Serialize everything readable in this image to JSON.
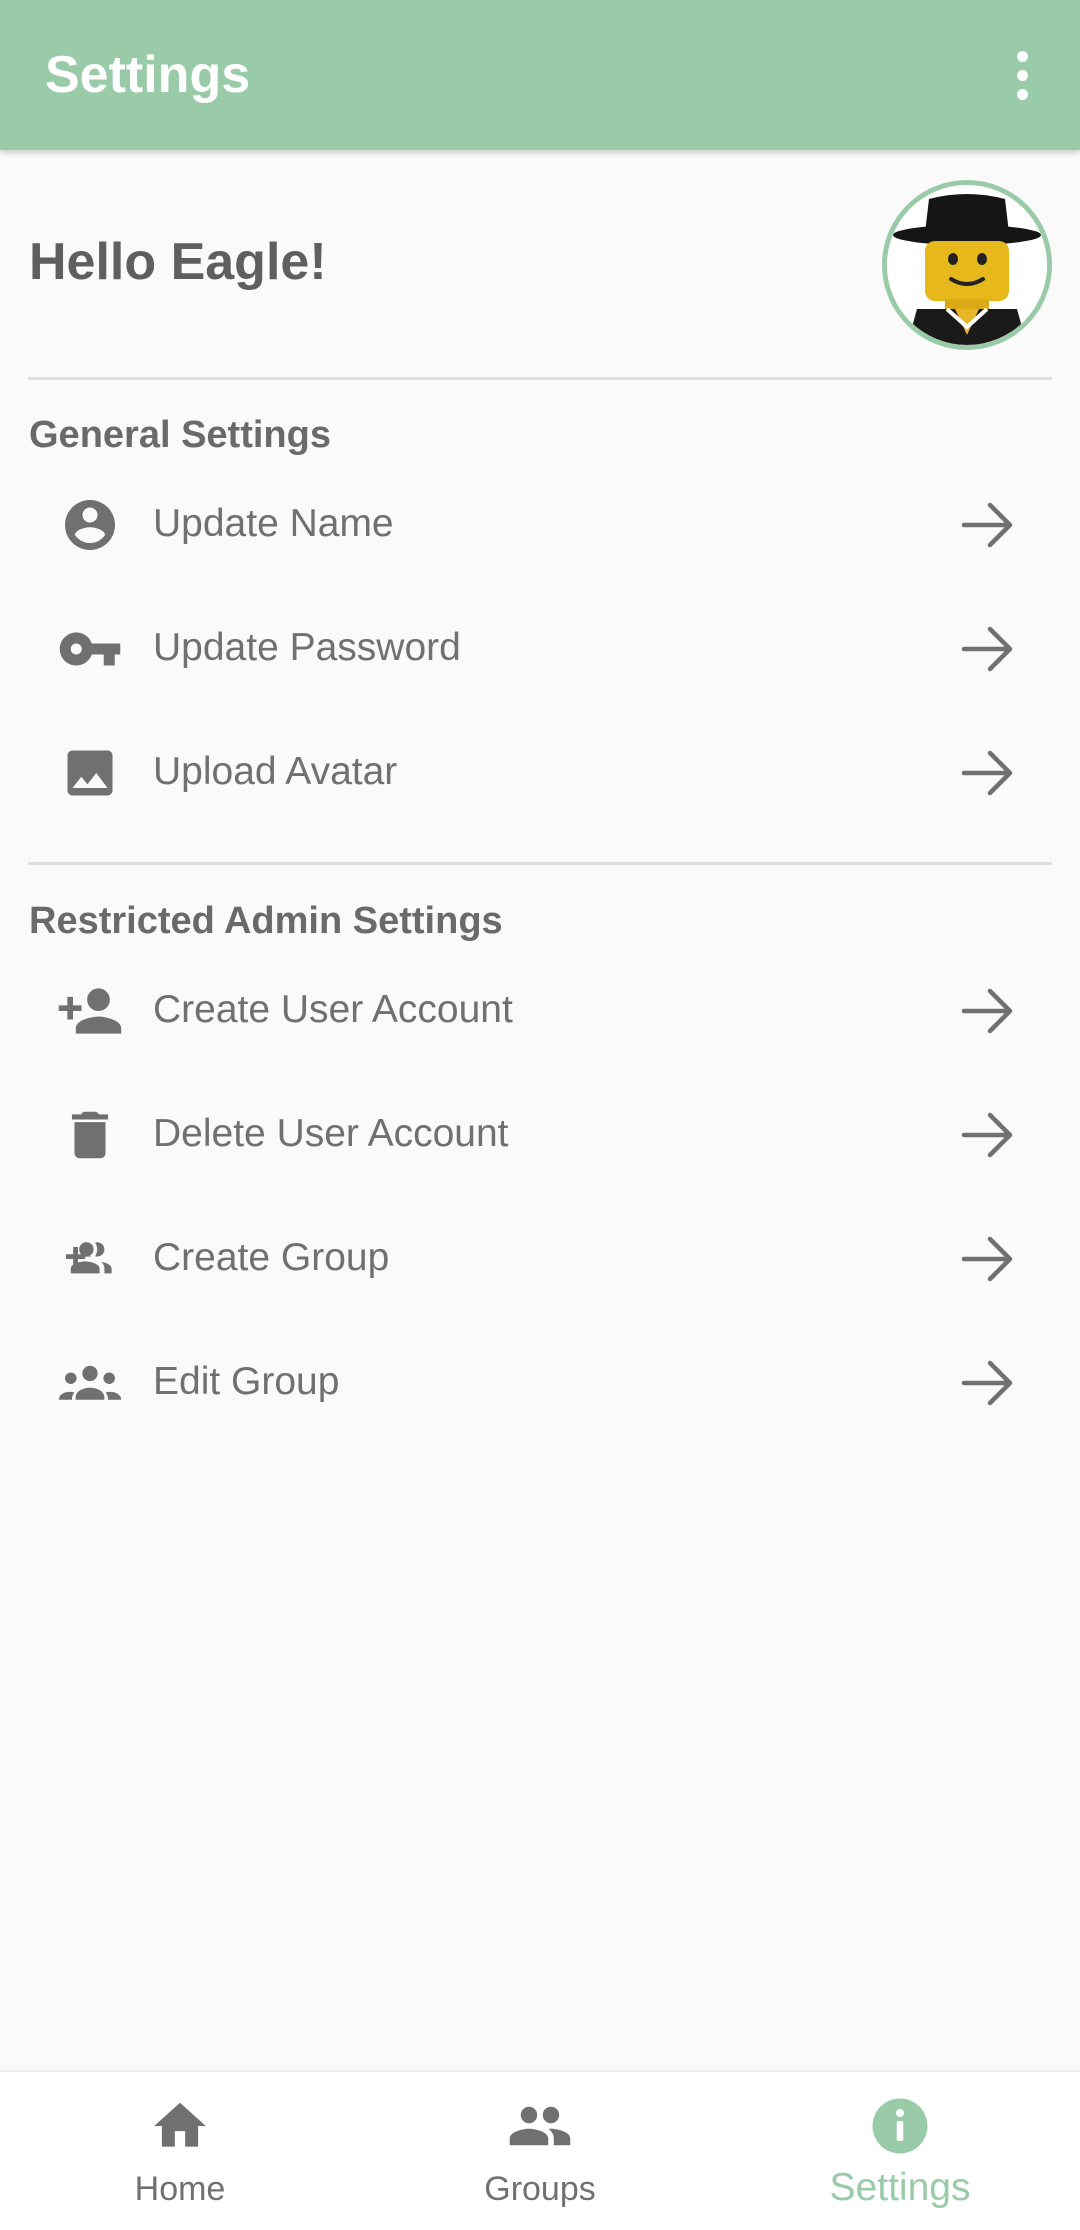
{
  "appbar": {
    "title": "Settings",
    "menu_icon": "more-vert-icon"
  },
  "greeting": "Hello Eagle!",
  "avatar": {
    "icon": "lego-minifigure-avatar"
  },
  "general": {
    "title": "General Settings",
    "items": [
      {
        "label": "Update Name",
        "icon": "account-circle-icon"
      },
      {
        "label": "Update Password",
        "icon": "key-icon"
      },
      {
        "label": "Upload Avatar",
        "icon": "image-icon"
      }
    ]
  },
  "admin": {
    "title": "Restricted Admin Settings",
    "items": [
      {
        "label": "Create User Account",
        "icon": "person-add-icon"
      },
      {
        "label": "Delete User Account",
        "icon": "trash-icon"
      },
      {
        "label": "Create Group",
        "icon": "group-add-icon"
      },
      {
        "label": "Edit Group",
        "icon": "groups-icon"
      }
    ]
  },
  "nav": {
    "items": [
      {
        "label": "Home",
        "icon": "home-icon"
      },
      {
        "label": "Groups",
        "icon": "people-icon"
      },
      {
        "label": "Settings",
        "icon": "info-icon",
        "active": true
      }
    ]
  },
  "colors": {
    "accent": "#99cba8",
    "text": "#707070",
    "background": "#fafafa"
  }
}
